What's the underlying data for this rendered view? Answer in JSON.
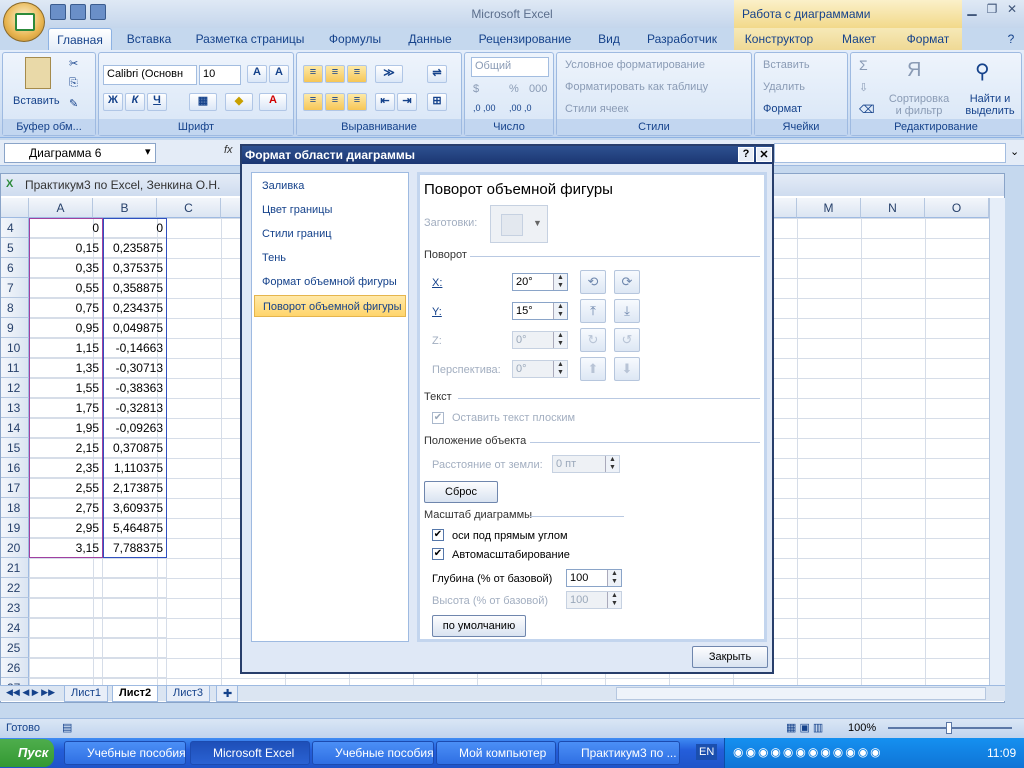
{
  "app": {
    "title": "Microsoft Excel",
    "context_title": "Работа с диаграммами"
  },
  "tabs": [
    "Главная",
    "Вставка",
    "Разметка страницы",
    "Формулы",
    "Данные",
    "Рецензирование",
    "Вид",
    "Разработчик",
    "Конструктор",
    "Макет",
    "Формат"
  ],
  "ribbon": {
    "clipboard": {
      "paste": "Вставить",
      "label": "Буфер обм..."
    },
    "font": {
      "name": "Calibri (Основн",
      "size": "10",
      "bold": "Ж",
      "italic": "К",
      "underline": "Ч",
      "label": "Шрифт"
    },
    "align": {
      "label": "Выравнивание"
    },
    "number": {
      "format": "Общий",
      "percent": "%",
      "thousands": "000",
      "label": "Число"
    },
    "styles": {
      "cond": "Условное форматирование",
      "table": "Форматировать как таблицу",
      "cell": "Стили ячеек",
      "label": "Стили"
    },
    "cells": {
      "insert": "Вставить",
      "delete": "Удалить",
      "format": "Формат",
      "label": "Ячейки"
    },
    "editing": {
      "sigma": "Σ",
      "sort": "Сортировка и фильтр",
      "find": "Найти и выделить",
      "label": "Редактирование"
    }
  },
  "formula_bar": {
    "name_box": "Диаграмма 6",
    "fx": "fx"
  },
  "workbook": {
    "title": "Практикум3 по Excel, Зенкина О.Н.",
    "columns": [
      "A",
      "B",
      "C",
      "",
      "",
      "",
      "",
      "",
      "",
      "",
      "",
      "L",
      "M",
      "N",
      "O"
    ],
    "rows": [
      {
        "n": "4",
        "a": "0",
        "b": "0"
      },
      {
        "n": "5",
        "a": "0,15",
        "b": "0,235875"
      },
      {
        "n": "6",
        "a": "0,35",
        "b": "0,375375"
      },
      {
        "n": "7",
        "a": "0,55",
        "b": "0,358875"
      },
      {
        "n": "8",
        "a": "0,75",
        "b": "0,234375"
      },
      {
        "n": "9",
        "a": "0,95",
        "b": "0,049875"
      },
      {
        "n": "10",
        "a": "1,15",
        "b": "-0,14663"
      },
      {
        "n": "11",
        "a": "1,35",
        "b": "-0,30713"
      },
      {
        "n": "12",
        "a": "1,55",
        "b": "-0,38363"
      },
      {
        "n": "13",
        "a": "1,75",
        "b": "-0,32813"
      },
      {
        "n": "14",
        "a": "1,95",
        "b": "-0,09263"
      },
      {
        "n": "15",
        "a": "2,15",
        "b": "0,370875"
      },
      {
        "n": "16",
        "a": "2,35",
        "b": "1,110375"
      },
      {
        "n": "17",
        "a": "2,55",
        "b": "2,173875"
      },
      {
        "n": "18",
        "a": "2,75",
        "b": "3,609375"
      },
      {
        "n": "19",
        "a": "2,95",
        "b": "5,464875"
      },
      {
        "n": "20",
        "a": "3,15",
        "b": "7,788375"
      },
      {
        "n": "21",
        "a": "",
        "b": ""
      },
      {
        "n": "22",
        "a": "",
        "b": ""
      },
      {
        "n": "23",
        "a": "",
        "b": ""
      },
      {
        "n": "24",
        "a": "",
        "b": ""
      },
      {
        "n": "25",
        "a": "",
        "b": ""
      },
      {
        "n": "26",
        "a": "",
        "b": ""
      },
      {
        "n": "27",
        "a": "",
        "b": ""
      }
    ],
    "sheets": [
      "Лист1",
      "Лист2",
      "Лист3"
    ]
  },
  "dialog": {
    "title": "Формат области диаграммы",
    "help": "?",
    "close": "✕",
    "nav": [
      "Заливка",
      "Цвет границы",
      "Стили границ",
      "Тень",
      "Формат объемной фигуры",
      "Поворот объемной фигуры"
    ],
    "heading": "Поворот объемной фигуры",
    "presets": "Заготовки:",
    "rotation": "Поворот",
    "x_label": "X:",
    "x_value": "20°",
    "y_label": "Y:",
    "y_value": "15°",
    "z_label": "Z:",
    "z_value": "0°",
    "persp_label": "Перспектива:",
    "persp_value": "0°",
    "text_section": "Текст",
    "keep_flat": "Оставить текст плоским",
    "position_section": "Положение объекта",
    "distance_label": "Расстояние от земли:",
    "distance_value": "0 пт",
    "reset": "Сброс",
    "scale_section": "Масштаб диаграммы",
    "right_angle": "оси под прямым углом",
    "autoscale": "Автомасштабирование",
    "depth_label": "Глубина (% от базовой)",
    "depth_value": "100",
    "height_label": "Высота (% от базовой)",
    "height_value": "100",
    "default": "по умолчанию",
    "close_btn": "Закрыть"
  },
  "status": {
    "ready": "Готово",
    "zoom": "100%"
  },
  "taskbar": {
    "start": "Пуск",
    "items": [
      "Учебные пособия",
      "Microsoft Excel",
      "Учебные пособия",
      "Мой компьютер",
      "Практикум3 по ..."
    ],
    "lang": "EN",
    "time": "11:09"
  }
}
